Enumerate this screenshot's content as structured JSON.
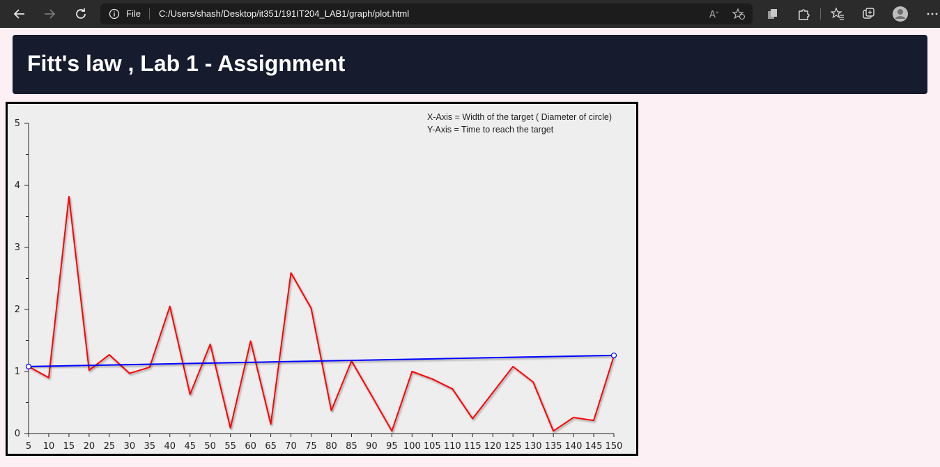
{
  "browser": {
    "file_label": "File",
    "url": "C:/Users/shash/Desktop/it351/191IT204_LAB1/graph/plot.html"
  },
  "page": {
    "title": "Fitt's law , Lab 1 - Assignment"
  },
  "chart_data": {
    "type": "line",
    "legend_lines": [
      "X-Axis = Width of the target ( Diameter of circle)",
      "Y-Axis = Time to reach the target"
    ],
    "legend_position": "top-right",
    "x": [
      5,
      10,
      15,
      20,
      25,
      30,
      35,
      40,
      45,
      50,
      55,
      60,
      65,
      70,
      75,
      80,
      85,
      90,
      95,
      100,
      105,
      110,
      115,
      120,
      125,
      130,
      135,
      140,
      145,
      150
    ],
    "xlim": [
      5,
      150
    ],
    "ylim": [
      0,
      5
    ],
    "y_ticks": [
      0,
      1,
      2,
      3,
      4,
      5
    ],
    "grid": false,
    "background": "#eeeeee",
    "series": [
      {
        "color": "#ff0000",
        "values": [
          1.08,
          0.9,
          3.82,
          1.02,
          1.27,
          0.97,
          1.07,
          2.05,
          0.63,
          1.44,
          0.09,
          1.49,
          0.15,
          2.59,
          2.02,
          0.37,
          1.17,
          0.61,
          0.04,
          1.0,
          0.88,
          0.72,
          0.24,
          0.66,
          1.08,
          0.83,
          0.04,
          0.26,
          0.21,
          1.25
        ]
      },
      {
        "color": "#0000ff",
        "x": [
          5,
          150
        ],
        "values": [
          1.08,
          1.26
        ],
        "markers": true
      }
    ]
  }
}
